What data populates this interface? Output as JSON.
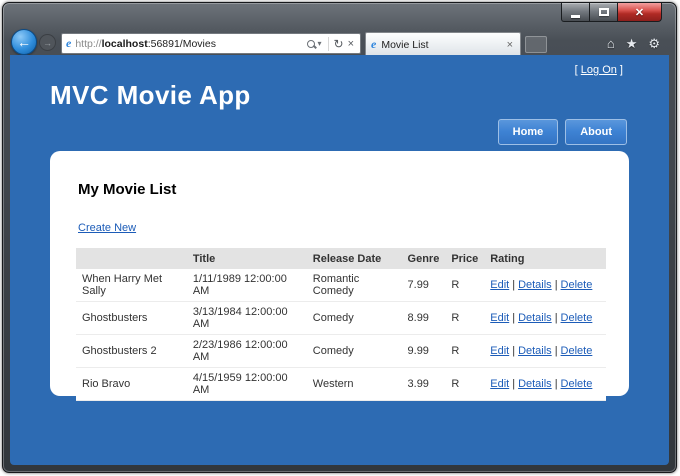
{
  "colors": {
    "page_blue": "#2d6bb3",
    "link_blue": "#1c5cb8",
    "close_red": "#b02a25"
  },
  "window": {
    "close_glyph": "✕"
  },
  "browser": {
    "back_glyph": "←",
    "forward_glyph": "→",
    "ie_glyph": "e",
    "dropdown_glyph": "▾",
    "refresh_glyph": "↻",
    "stop_glyph": "×",
    "home_glyph": "⌂",
    "star_glyph": "★",
    "gear_glyph": "⚙",
    "address": {
      "protocol": "http://",
      "host": "localhost",
      "path": ":56891/Movies"
    },
    "tab_title": "Movie List"
  },
  "page": {
    "logon": {
      "prefix": "[ ",
      "label": "Log On",
      "suffix": " ]"
    },
    "title": "MVC Movie App",
    "nav": [
      {
        "label": "Home"
      },
      {
        "label": "About"
      }
    ],
    "content": {
      "heading": "My Movie List",
      "create_link": "Create New",
      "table": {
        "headers": [
          "",
          "Title",
          "Release Date",
          "Genre",
          "Price",
          "Rating"
        ],
        "action_sep": "|",
        "actions": [
          "Edit",
          "Details",
          "Delete"
        ],
        "rows": [
          {
            "name": "When Harry Met Sally",
            "date": "1/11/1989 12:00:00 AM",
            "genre": "Romantic Comedy",
            "price": "7.99",
            "rating": "R"
          },
          {
            "name": "Ghostbusters",
            "date": "3/13/1984 12:00:00 AM",
            "genre": "Comedy",
            "price": "8.99",
            "rating": "R"
          },
          {
            "name": "Ghostbusters 2",
            "date": "2/23/1986 12:00:00 AM",
            "genre": "Comedy",
            "price": "9.99",
            "rating": "R"
          },
          {
            "name": "Rio Bravo",
            "date": "4/15/1959 12:00:00 AM",
            "genre": "Western",
            "price": "3.99",
            "rating": "R"
          }
        ]
      }
    }
  }
}
